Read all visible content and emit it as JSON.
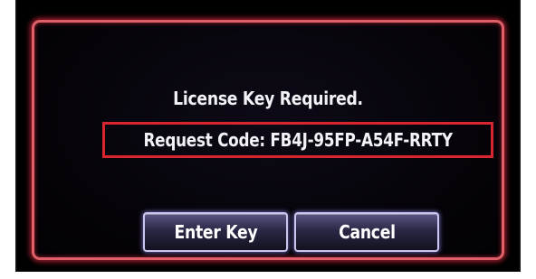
{
  "dialog": {
    "title": "License Key Required.",
    "request_code": "Request Code: FB4J-95FP-A54F-RRTY"
  },
  "buttons": {
    "enter_key": "Enter Key",
    "cancel": "Cancel"
  },
  "colors": {
    "bezel_glow": "#e0606a",
    "highlight_box": "#d9252d",
    "button_border": "#c9c6f0",
    "text": "#f2f2f7"
  }
}
